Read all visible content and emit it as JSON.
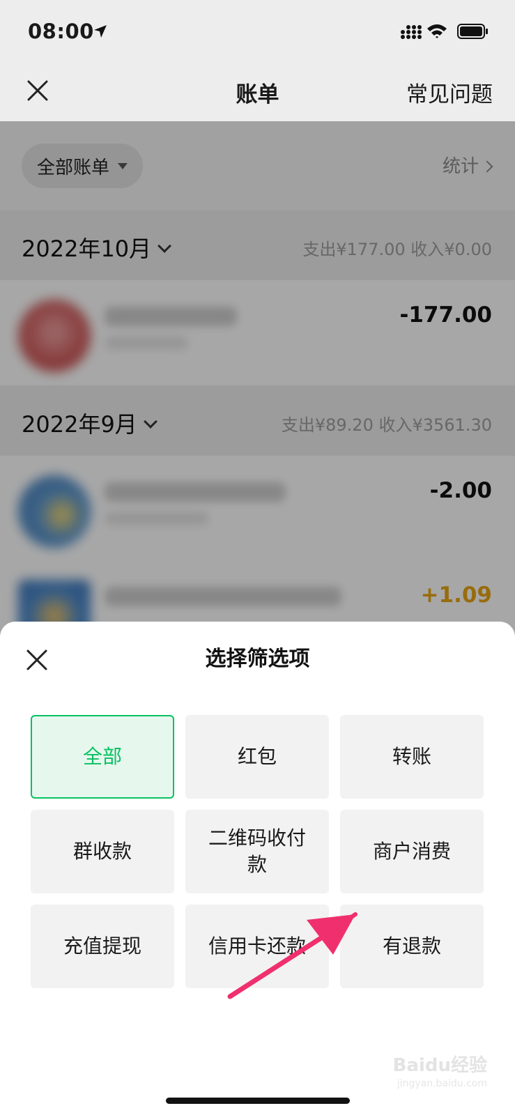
{
  "status_bar": {
    "time": "08:00",
    "icons": [
      "location-arrow-icon",
      "signal-bars-icon",
      "wifi-icon",
      "battery-icon"
    ]
  },
  "navbar": {
    "title": "账单",
    "faq_label": "常见问题",
    "close_icon": "close-icon"
  },
  "filter_bar": {
    "filter_label": "全部账单",
    "stats_label": "统计"
  },
  "months": [
    {
      "title": "2022年10月",
      "summary": "支出¥177.00  收入¥0.00",
      "transactions": [
        {
          "amount": "-177.00"
        }
      ]
    },
    {
      "title": "2022年9月",
      "summary": "支出¥89.20  收入¥3561.30",
      "transactions": [
        {
          "amount": "-2.00"
        },
        {
          "amount": "+1.09"
        }
      ]
    }
  ],
  "sheet": {
    "title": "选择筛选项",
    "options": [
      {
        "label": "全部",
        "selected": true
      },
      {
        "label": "红包",
        "selected": false
      },
      {
        "label": "转账",
        "selected": false
      },
      {
        "label": "群收款",
        "selected": false
      },
      {
        "label": "二维码收付款",
        "selected": false
      },
      {
        "label": "商户消费",
        "selected": false
      },
      {
        "label": "充值提现",
        "selected": false
      },
      {
        "label": "信用卡还款",
        "selected": false
      },
      {
        "label": "有退款",
        "selected": false
      }
    ]
  },
  "colors": {
    "accent": "#07c160",
    "income": "#e0a014",
    "annotation_arrow": "#f0306e"
  },
  "watermark": {
    "brand": "Baidu经验",
    "url": "jingyan.baidu.com"
  }
}
